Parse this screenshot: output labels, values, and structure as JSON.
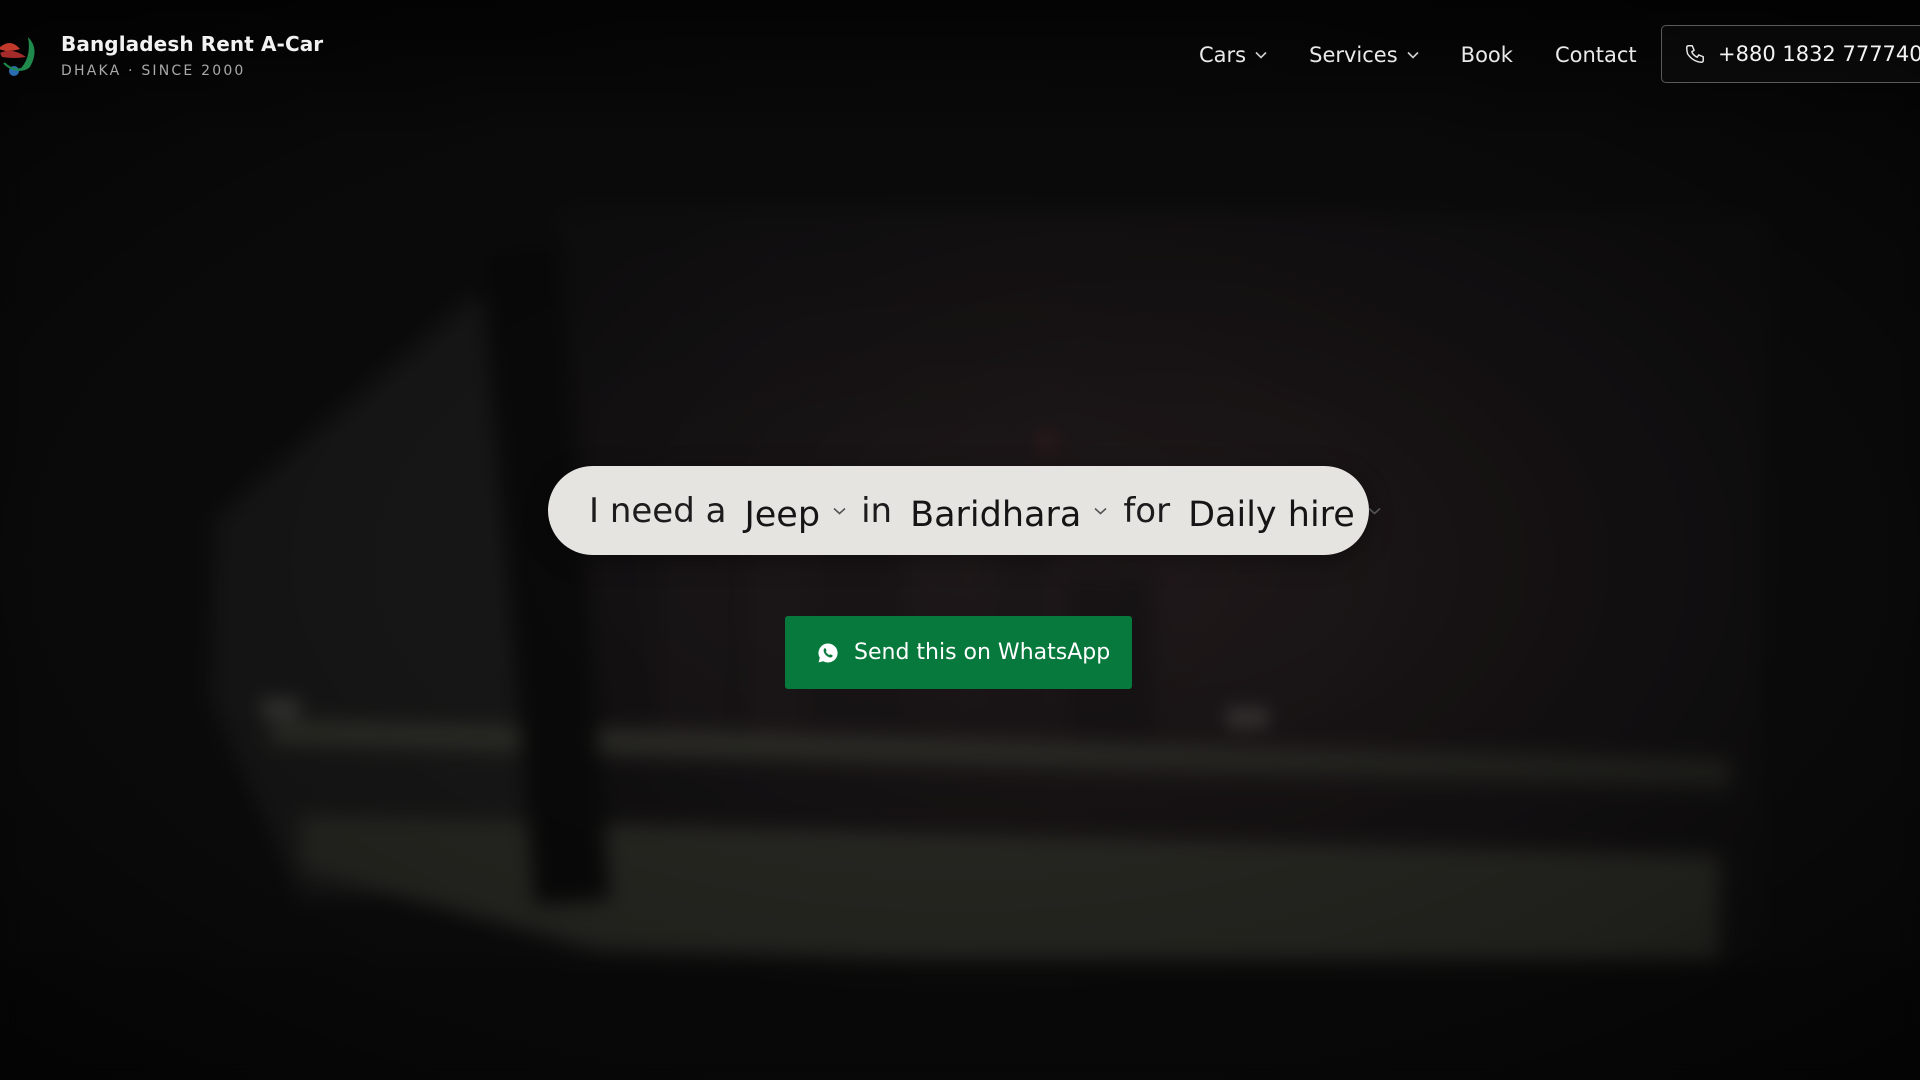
{
  "brand": {
    "name": "Bangladesh Rent A-Car",
    "tagline": "DHAKA · SINCE 2000",
    "logo_icon": "eagle-logo-icon"
  },
  "nav": {
    "cars": "Cars",
    "services": "Services",
    "book": "Book",
    "contact": "Contact",
    "dropdown_icon": "chevron-down-icon"
  },
  "phone": {
    "icon": "phone-icon",
    "number": "+880 1832 777740"
  },
  "builder": {
    "prefix": "I need a",
    "vehicle": "Jeep",
    "connector_in": "in",
    "location": "Baridhara",
    "connector_for": "for",
    "duration": "Daily hire"
  },
  "cta": {
    "icon": "whatsapp-icon",
    "label": "Send this on WhatsApp"
  },
  "colors": {
    "background": "#0d0d0e",
    "pill": "#e6e4e1",
    "whatsapp_green": "#07793d",
    "nav_text": "#e9e9e9"
  }
}
